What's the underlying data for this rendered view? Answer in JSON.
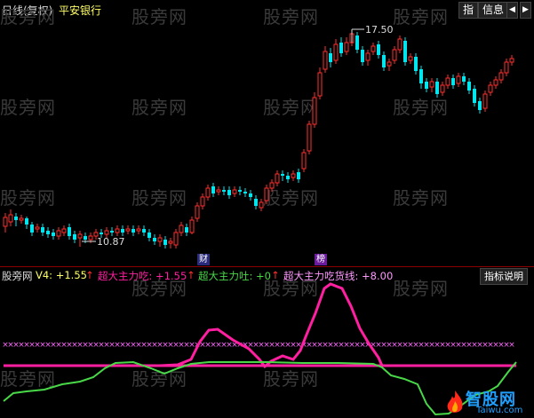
{
  "title_bar": {
    "period": "日线(复权)",
    "stock_name": "平安银行",
    "btn_index": "指",
    "btn_info": "信息",
    "nav_left": "◀",
    "nav_right": "▶"
  },
  "price_chart": {
    "high_label": "17.50",
    "low_label": "10.87",
    "tag_cai": "财",
    "tag_bang": "榜"
  },
  "indicator": {
    "name": "股旁网",
    "v4": "V4: +1.55",
    "line1": "超大主力吃: +1.55",
    "line2": "超大主力吐: +0",
    "line3": "超大主力吃货线: +8.00",
    "help_btn": "指标说明"
  },
  "colors": {
    "up": "#ff3030",
    "down": "#00e5ee",
    "magenta": "#ff1fa0",
    "green": "#48d848",
    "dotted": "#ff66ff"
  },
  "watermark": "股旁网",
  "logo": {
    "name": "智股网",
    "url": "Taiwu.com"
  }
}
